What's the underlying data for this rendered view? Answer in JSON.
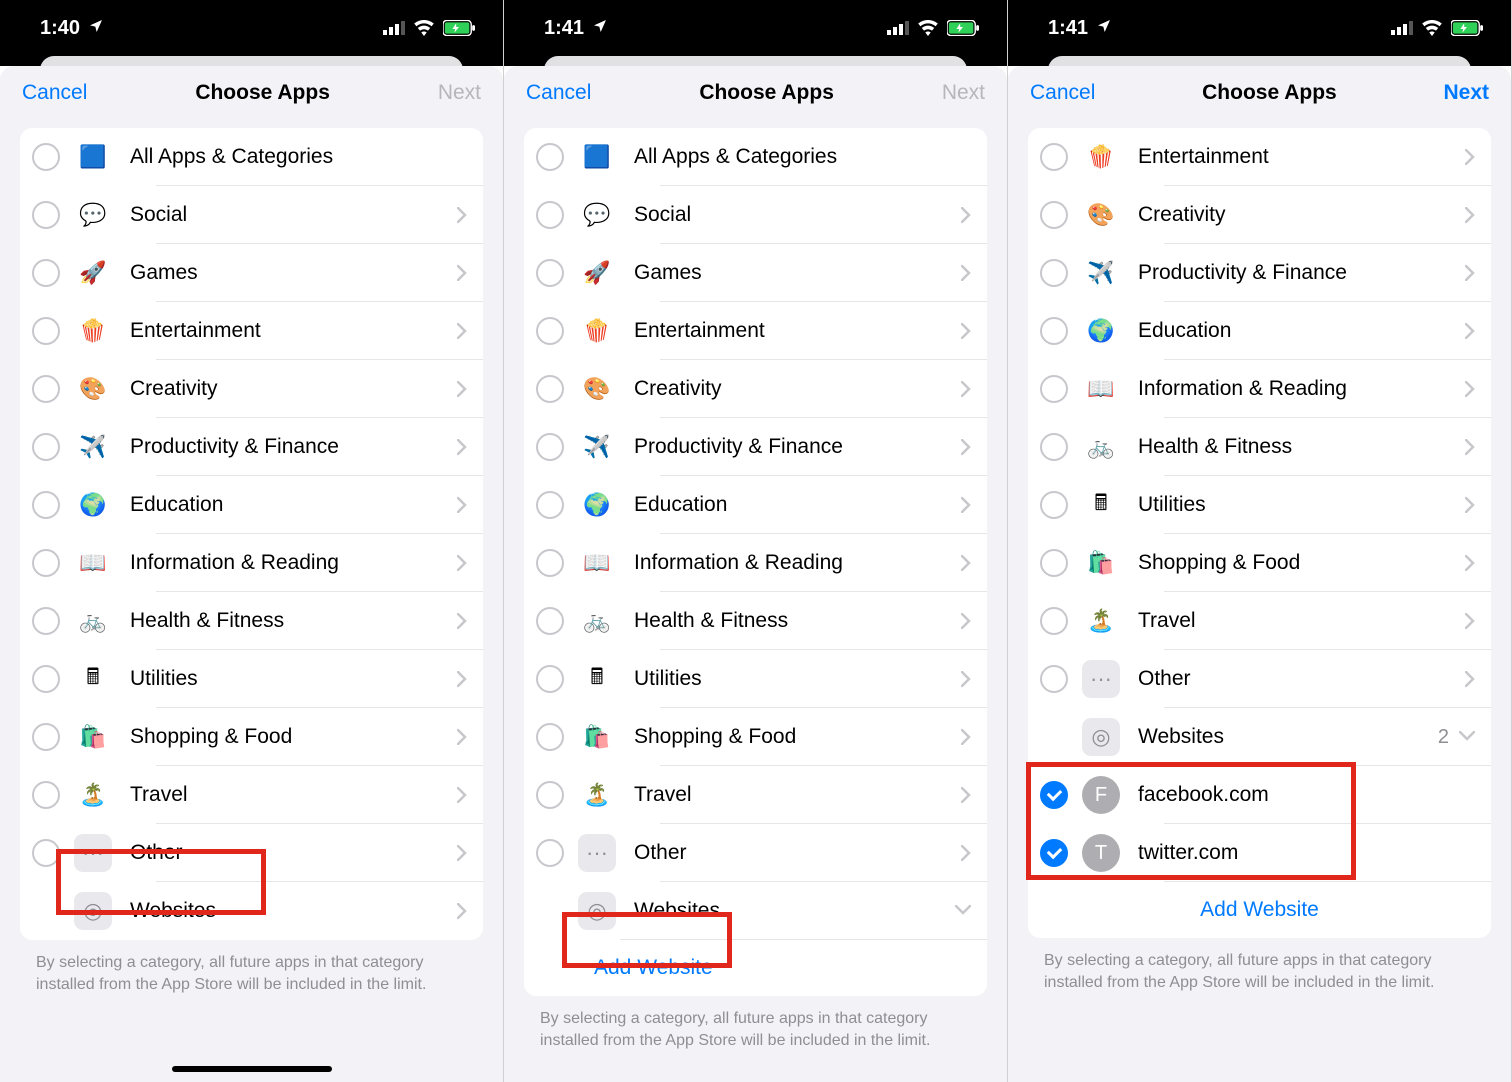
{
  "status": {
    "times": [
      "1:40",
      "1:41",
      "1:41"
    ]
  },
  "nav": {
    "cancel": "Cancel",
    "title": "Choose Apps",
    "next": "Next"
  },
  "categories": {
    "allApps": "All Apps & Categories",
    "social": "Social",
    "games": "Games",
    "entertainment": "Entertainment",
    "creativity": "Creativity",
    "prodFinance": "Productivity & Finance",
    "education": "Education",
    "infoReading": "Information & Reading",
    "healthFitness": "Health & Fitness",
    "utilities": "Utilities",
    "shoppingFood": "Shopping & Food",
    "travel": "Travel",
    "other": "Other",
    "websites": "Websites"
  },
  "icons": {
    "allApps": "🟦",
    "social": "💬",
    "games": "🚀",
    "entertainment": "🍿",
    "creativity": "🎨",
    "prodFinance": "✈️",
    "education": "🌍",
    "infoReading": "📖",
    "healthFitness": "🚲",
    "utilities": "🖩",
    "shoppingFood": "🛍️",
    "travel": "🏝️",
    "other": "···",
    "websites": "◎"
  },
  "addWebsite": "Add Website",
  "websites": {
    "count": "2",
    "items": [
      {
        "letter": "F",
        "label": "facebook.com"
      },
      {
        "letter": "T",
        "label": "twitter.com"
      }
    ]
  },
  "footer": "By selecting a category, all future apps in that category installed from the App Store will be included in the limit."
}
